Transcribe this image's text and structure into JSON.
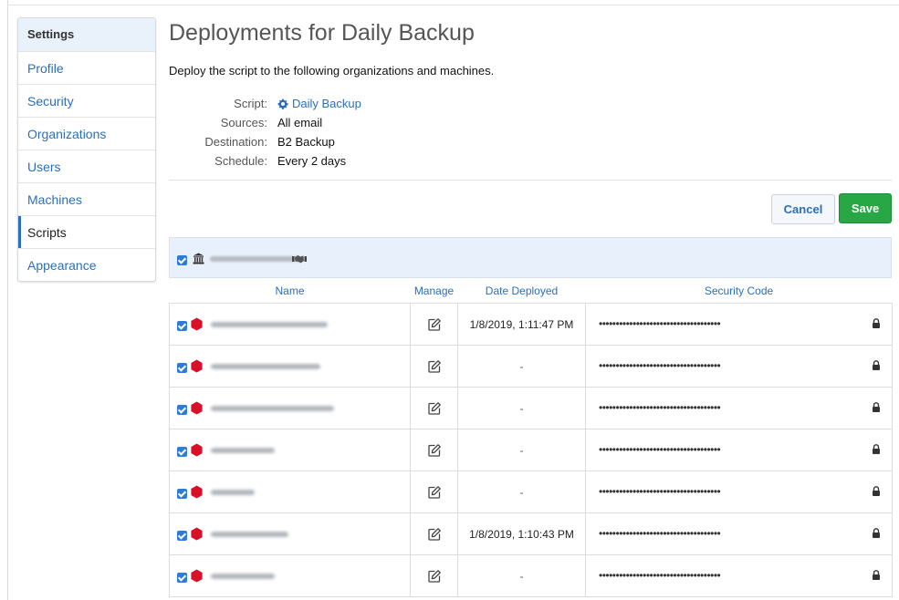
{
  "sidebar": {
    "header": "Settings",
    "items": [
      {
        "label": "Profile"
      },
      {
        "label": "Security"
      },
      {
        "label": "Organizations"
      },
      {
        "label": "Users"
      },
      {
        "label": "Machines"
      },
      {
        "label": "Scripts",
        "active": true
      },
      {
        "label": "Appearance"
      }
    ]
  },
  "page": {
    "title": "Deployments for Daily Backup",
    "intro": "Deploy the script to the following organizations and machines.",
    "meta": {
      "script_label": "Script:",
      "script_value": "Daily Backup",
      "script_icon": "gear-icon",
      "sources_label": "Sources:",
      "sources_value": "All email",
      "destination_label": "Destination:",
      "destination_value": "B2 Backup",
      "schedule_label": "Schedule:",
      "schedule_value": "Every 2 days"
    }
  },
  "actions": {
    "cancel_label": "Cancel",
    "save_label": "Save"
  },
  "organization": {
    "checked": true,
    "icons": [
      "bank-icon",
      "handshake-icon"
    ]
  },
  "table": {
    "columns": {
      "name": "Name",
      "manage": "Manage",
      "date_deployed": "Date Deployed",
      "security_code": "Security Code"
    },
    "rows": [
      {
        "checked": true,
        "date": "1/8/2019, 1:11:47 PM",
        "code": "••••••••••••••••••••••••••••••••••••"
      },
      {
        "checked": true,
        "date": "-",
        "code": "••••••••••••••••••••••••••••••••••••"
      },
      {
        "checked": true,
        "date": "-",
        "code": "••••••••••••••••••••••••••••••••••••"
      },
      {
        "checked": true,
        "date": "-",
        "code": "••••••••••••••••••••••••••••••••••••"
      },
      {
        "checked": true,
        "date": "-",
        "code": "••••••••••••••••••••••••••••••••••••"
      },
      {
        "checked": true,
        "date": "1/8/2019, 1:10:43 PM",
        "code": "••••••••••••••••••••••••••••••••••••"
      },
      {
        "checked": true,
        "date": "-",
        "code": "••••••••••••••••••••••••••••••••••••"
      }
    ]
  },
  "colors": {
    "accent": "#2a6fbb",
    "save": "#28a745",
    "machine_icon": "#d8102a",
    "org_bar": "#e8f1fb"
  }
}
